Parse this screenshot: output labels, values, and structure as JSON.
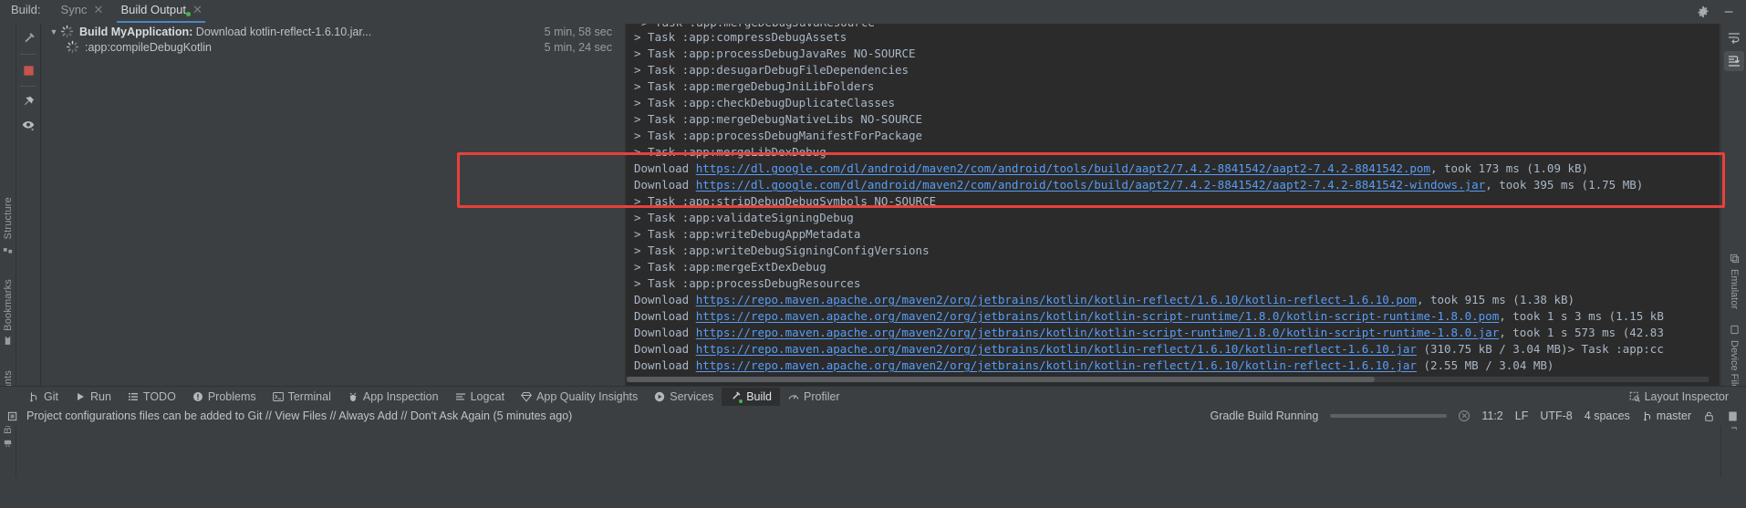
{
  "window": {
    "tool_window_title": "Build:",
    "tabs": [
      {
        "label": "Sync",
        "selected": false,
        "has_close": true,
        "running_dot": false
      },
      {
        "label": "Build Output",
        "selected": true,
        "has_close": true,
        "running_dot": true
      }
    ],
    "header_icons": [
      "gear-icon",
      "minimize-icon"
    ],
    "right_panel_icons": [
      "soft-wrap-icon",
      "scroll-to-end-icon"
    ]
  },
  "left_stripe": {
    "items": [
      {
        "label": "Structure",
        "icon": "structure-icon"
      },
      {
        "label": "Bookmarks",
        "icon": "bookmarks-icon"
      },
      {
        "label": "Build Variants",
        "icon": "build-variants-icon"
      }
    ]
  },
  "right_stripe": {
    "items": [
      {
        "label": "Emulator",
        "icon": "emulator-icon"
      },
      {
        "label": "Device File Explorer",
        "icon": "device-file-explorer-icon"
      }
    ]
  },
  "panel_toolbar": {
    "buttons": [
      {
        "icon": "build-hammer-icon"
      },
      {
        "icon": "stop-icon"
      },
      {
        "icon": "pin-icon"
      },
      {
        "icon": "eye-icon"
      }
    ]
  },
  "build_tree": {
    "rows": [
      {
        "indent": 0,
        "arrow": "chevron-down-icon",
        "icon": "spinner-icon",
        "title": "Build MyApplication:",
        "detail": " Download kotlin-reflect-1.6.10.jar...",
        "time": "5 min, 58 sec"
      },
      {
        "indent": 1,
        "arrow": "",
        "icon": "spinner-icon",
        "title": "",
        "detail": ":app:compileDebugKotlin",
        "time": "5 min, 24 sec"
      }
    ]
  },
  "console": {
    "partial_first_line": "> Task :app:mergeDebugJavaResource",
    "lines": [
      {
        "type": "task",
        "text": "> Task :app:compressDebugAssets"
      },
      {
        "type": "task",
        "text": "> Task :app:processDebugJavaRes NO-SOURCE"
      },
      {
        "type": "task",
        "text": "> Task :app:desugarDebugFileDependencies"
      },
      {
        "type": "task",
        "text": "> Task :app:mergeDebugJniLibFolders"
      },
      {
        "type": "task",
        "text": "> Task :app:checkDebugDuplicateClasses"
      },
      {
        "type": "task",
        "text": "> Task :app:mergeDebugNativeLibs NO-SOURCE"
      },
      {
        "type": "task",
        "text": "> Task :app:processDebugManifestForPackage"
      },
      {
        "type": "task",
        "text": "> Task :app:mergeLibDexDebug"
      },
      {
        "type": "download",
        "prefix": "Download ",
        "url": "https://dl.google.com/dl/android/maven2/com/android/tools/build/aapt2/7.4.2-8841542/aapt2-7.4.2-8841542.pom",
        "suffix": ", took 173 ms (1.09 kB)"
      },
      {
        "type": "download",
        "prefix": "Download ",
        "url": "https://dl.google.com/dl/android/maven2/com/android/tools/build/aapt2/7.4.2-8841542/aapt2-7.4.2-8841542-windows.jar",
        "suffix": ", took 395 ms (1.75 MB)"
      },
      {
        "type": "task",
        "text": "> Task :app:stripDebugDebugSymbols NO-SOURCE"
      },
      {
        "type": "task",
        "text": "> Task :app:validateSigningDebug"
      },
      {
        "type": "task",
        "text": "> Task :app:writeDebugAppMetadata"
      },
      {
        "type": "task",
        "text": "> Task :app:writeDebugSigningConfigVersions"
      },
      {
        "type": "task",
        "text": "> Task :app:mergeExtDexDebug"
      },
      {
        "type": "task",
        "text": "> Task :app:processDebugResources"
      },
      {
        "type": "download",
        "prefix": "Download ",
        "url": "https://repo.maven.apache.org/maven2/org/jetbrains/kotlin/kotlin-reflect/1.6.10/kotlin-reflect-1.6.10.pom",
        "suffix": ", took 915 ms (1.38 kB)"
      },
      {
        "type": "download",
        "prefix": "Download ",
        "url": "https://repo.maven.apache.org/maven2/org/jetbrains/kotlin/kotlin-script-runtime/1.8.0/kotlin-script-runtime-1.8.0.pom",
        "suffix": ", took 1 s 3 ms (1.15 kB"
      },
      {
        "type": "download",
        "prefix": "Download ",
        "url": "https://repo.maven.apache.org/maven2/org/jetbrains/kotlin/kotlin-script-runtime/1.8.0/kotlin-script-runtime-1.8.0.jar",
        "suffix": ", took 1 s 573 ms (42.83"
      },
      {
        "type": "download",
        "prefix": "Download ",
        "url": "https://repo.maven.apache.org/maven2/org/jetbrains/kotlin/kotlin-reflect/1.6.10/kotlin-reflect-1.6.10.jar",
        "suffix": " (310.75 kB / 3.04 MB)> Task :app:cc"
      },
      {
        "type": "download",
        "prefix": "Download ",
        "url": "https://repo.maven.apache.org/maven2/org/jetbrains/kotlin/kotlin-reflect/1.6.10/kotlin-reflect-1.6.10.jar",
        "suffix": " (2.55 MB / 3.04 MB)"
      }
    ],
    "highlight_color": "#e8413b",
    "link_color": "#589df6"
  },
  "bottom_bar": {
    "items": [
      {
        "label": "Git",
        "icon": "git-branch-icon",
        "active": false,
        "running_dot": false
      },
      {
        "label": "Run",
        "icon": "run-icon",
        "active": false,
        "running_dot": false
      },
      {
        "label": "TODO",
        "icon": "todo-icon",
        "active": false,
        "running_dot": false
      },
      {
        "label": "Problems",
        "icon": "problems-icon",
        "active": false,
        "running_dot": false
      },
      {
        "label": "Terminal",
        "icon": "terminal-icon",
        "active": false,
        "running_dot": false
      },
      {
        "label": "App Inspection",
        "icon": "app-inspection-icon",
        "active": false,
        "running_dot": false
      },
      {
        "label": "Logcat",
        "icon": "logcat-icon",
        "active": false,
        "running_dot": false
      },
      {
        "label": "App Quality Insights",
        "icon": "app-quality-insights-icon",
        "active": false,
        "running_dot": false
      },
      {
        "label": "Services",
        "icon": "services-icon",
        "active": false,
        "running_dot": false
      },
      {
        "label": "Build",
        "icon": "build-hammer-icon",
        "active": true,
        "running_dot": true
      },
      {
        "label": "Profiler",
        "icon": "profiler-icon",
        "active": false,
        "running_dot": false
      }
    ],
    "right_item": {
      "label": "Layout Inspector",
      "icon": "layout-inspector-icon"
    }
  },
  "status_bar": {
    "notification": "Project configurations files can be added to Git // View Files // Always Add // Don't Ask Again (5 minutes ago)",
    "notification_icon": "event-log-icon",
    "progress_text": "Gradle Build Running",
    "caret_position": "11:2",
    "line_separator": "LF",
    "encoding": "UTF-8",
    "indent": "4 spaces",
    "branch": "master",
    "branch_icon": "git-branch-icon",
    "lock_icon": "lock-icon",
    "inspector_icon": "memory-indicator-icon"
  }
}
